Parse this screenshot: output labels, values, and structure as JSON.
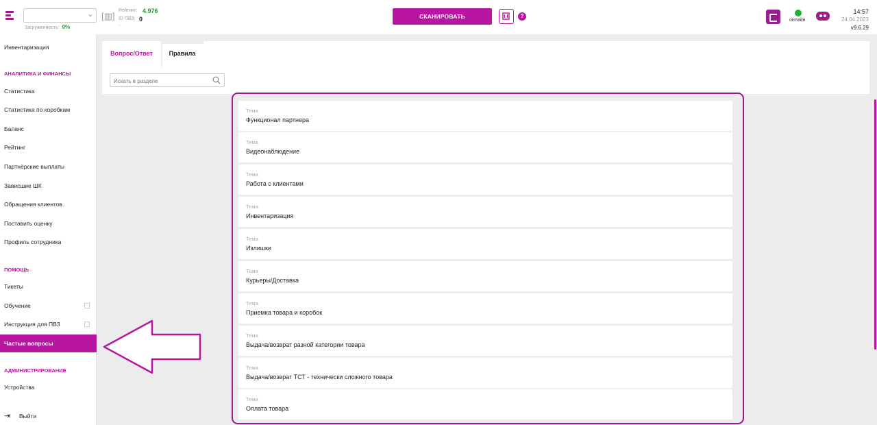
{
  "header": {
    "workload_label": "Загруженность:",
    "workload_value": "0%",
    "rating_label": "Рейтинг:",
    "rating_value": "4.976",
    "pvz_label": "ID ПВЗ:",
    "pvz_value": "0",
    "pvz_extra": "-",
    "scan_button": "СКАНИРОВАТЬ",
    "help": "?",
    "online_label": "онлайн",
    "time": "14:57",
    "date": "24.04.2023",
    "version": "v9.6.29"
  },
  "sidebar": {
    "items_top": [
      "Инвентаризация"
    ],
    "section_analytics": "АНАЛИТИКА И ФИНАНСЫ",
    "analytics_items": [
      "Статистика",
      "Статистика по коробкам",
      "Баланс",
      "Рейтинг",
      "Партнёрские выплаты",
      "Зависшие ШК",
      "Обращения клиентов",
      "Поставить оценку",
      "Профиль сотрудника"
    ],
    "section_help": "ПОМОЩЬ",
    "help_items": [
      "Тикеты",
      "Обучение",
      "Инструкция для ПВЗ",
      "Частые вопросы"
    ],
    "section_admin": "АДМИНИСТРИРОВАНИЕ",
    "admin_items": [
      "Устройства"
    ],
    "exit": "Выйти"
  },
  "main": {
    "tabs": [
      "Вопрос/Ответ",
      "Правила"
    ],
    "search_placeholder": "Искать в разделе",
    "topic_label": "Тема",
    "topics": [
      "Функционал партнера",
      "Видеонаблюдение",
      "Работа с клиентами",
      "Инвентаризация",
      "Излишки",
      "Курьеры/Доставка",
      "Приемка товара и коробок",
      "Выдача/возврат разной категории товара",
      "Выдача/возврат ТСТ - технически сложного товара",
      "Оплата товара"
    ]
  },
  "colors": {
    "accent": "#b8169f",
    "online": "#1cb52e",
    "rating": "#1c9b2e"
  }
}
